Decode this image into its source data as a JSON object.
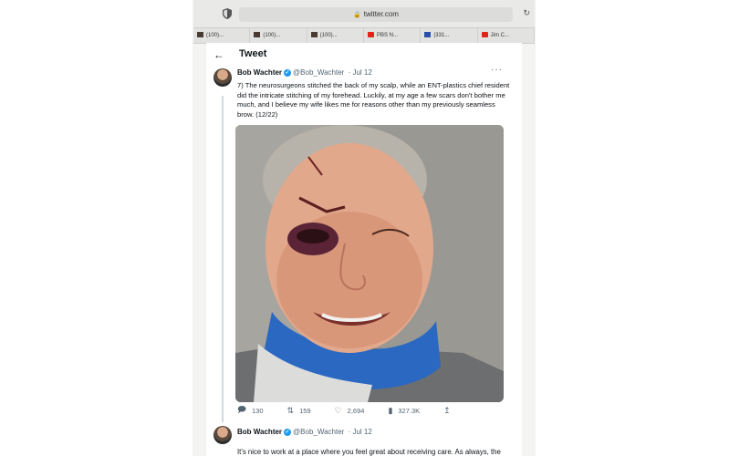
{
  "browser": {
    "url": "twitter.com",
    "tabs": [
      {
        "label": "(100)...",
        "icon": "twitter-dark-icon"
      },
      {
        "label": "(100)...",
        "icon": "twitter-dark-icon"
      },
      {
        "label": "(100)...",
        "icon": "twitter-dark-icon"
      },
      {
        "label": "PBS N...",
        "icon": "youtube-icon"
      },
      {
        "label": "(331...",
        "icon": "mail-icon"
      },
      {
        "label": "Jim C...",
        "icon": "youtube-icon"
      }
    ]
  },
  "header": {
    "title": "Tweet"
  },
  "tweets": [
    {
      "author": "Bob Wachter",
      "handle": "@Bob_Wachter",
      "date": "· Jul 12",
      "text": "7) The neurosurgeons stitched the back of my scalp, while an ENT-plastics chief resident did the intricate stitching of my forehead. Luckily, at my age a few scars don't bother me much, and I believe my wife likes me for reasons other than my previously seamless brow. (12/22)",
      "stats": {
        "replies": "130",
        "retweets": "159",
        "likes": "2,694",
        "views": "327.3K"
      }
    },
    {
      "author": "Bob Wachter",
      "handle": "@Bob_Wachter",
      "date": "· Jul 12",
      "text": "It's nice to work at a place where you feel great about receiving care. As always, the nurses and..."
    }
  ],
  "colors": {
    "accent": "#1d9bf0",
    "text": "#0f1419",
    "muted": "#536471"
  }
}
